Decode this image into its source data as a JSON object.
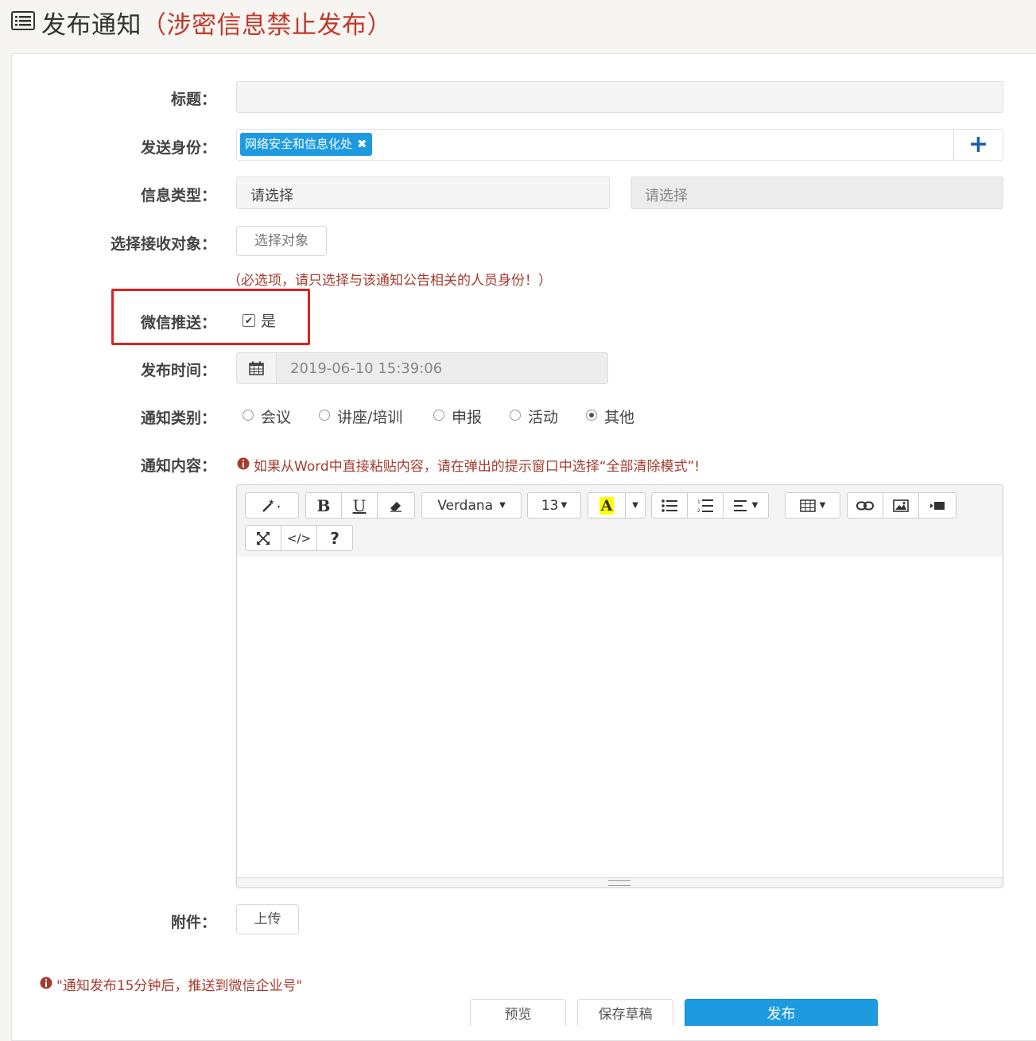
{
  "page": {
    "title": "发布通知",
    "warning": "（涉密信息禁止发布）"
  },
  "form": {
    "title_label": "标题：",
    "title_value": "",
    "sender_label": "发送身份：",
    "sender_tag": "网络安全和信息化处",
    "sender_tag_remove": "✖",
    "add_sender": "+",
    "type_label": "信息类型：",
    "type_select1": "请选择",
    "type_select2": "请选择",
    "recipients_label": "选择接收对象：",
    "recipients_button": "选择对象",
    "recipients_hint": "（必选项，请只选择与该通知公告相关的人员身份！）",
    "wechat_label": "微信推送：",
    "wechat_checked": true,
    "wechat_option": "是",
    "time_label": "发布时间：",
    "time_value": "2019-06-10 15:39:06",
    "category_label": "通知类别：",
    "categories": [
      "会议",
      "讲座/培训",
      "申报",
      "活动",
      "其他"
    ],
    "category_selected": "其他",
    "content_label": "通知内容：",
    "content_hint": "如果从Word中直接粘贴内容，请在弹出的提示窗口中选择“全部清除模式”!",
    "attachment_label": "附件：",
    "upload_button": "上传"
  },
  "editor": {
    "font_name": "Verdana",
    "font_size": "13",
    "bold": "B",
    "underline": "U",
    "help": "?",
    "code": "</>",
    "color_letter": "A"
  },
  "footer": {
    "notice": "\"通知发布15分钟后，推送到微信企业号\"",
    "preview": "预览",
    "save_draft": "保存草稿",
    "publish": "发布"
  },
  "colors": {
    "accent": "#1e9be0",
    "warning": "#c0392b",
    "highlight_box": "#e02020"
  }
}
